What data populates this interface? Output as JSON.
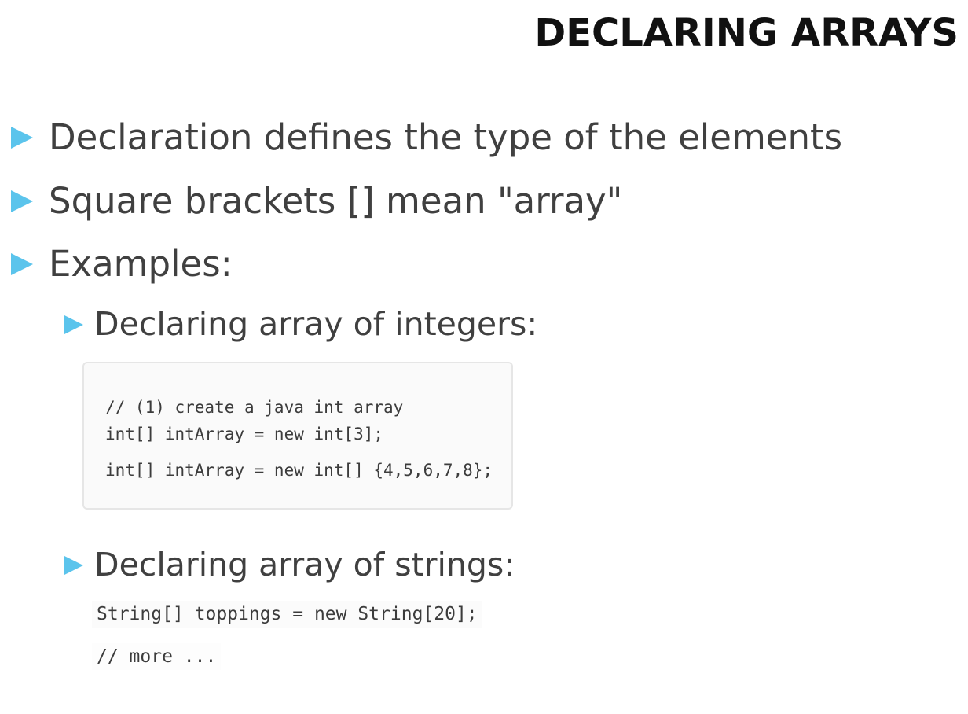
{
  "slide": {
    "title": "DECLARING ARRAYS",
    "bullets": [
      "Declaration defines the type of the elements",
      "Square brackets [] mean \"array\"",
      "Examples:"
    ],
    "sub_bullets": [
      "Declaring array of integers:",
      "Declaring array of strings:"
    ],
    "int_code": [
      "// (1) create a java int array",
      "int[] intArray = new int[3];",
      "int[] intArray = new int[] {4,5,6,7,8};"
    ],
    "string_code": [
      "String[] toppings = new String[20];",
      "// more ..."
    ]
  },
  "colors": {
    "bullet_arrow": "#5bc4ec",
    "title": "#111111",
    "body_text": "#404040"
  },
  "icons": {
    "bullet": "triangle-right-icon"
  }
}
